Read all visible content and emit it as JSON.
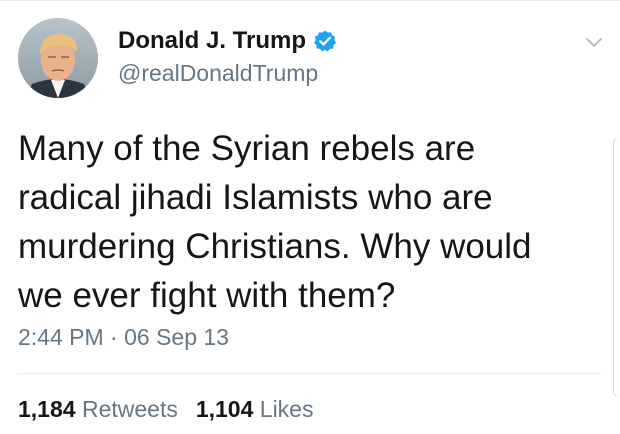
{
  "author": {
    "display_name": "Donald J. Trump",
    "handle": "@realDonaldTrump",
    "verified": true
  },
  "tweet": {
    "text_lines": [
      "Many of the Syrian rebels are",
      "radical jihadi Islamists who are",
      "murdering Christians. Why would",
      "we ever fight with them?"
    ],
    "timestamp": "2:44 PM · 06 Sep 13"
  },
  "stats": {
    "retweets_count": "1,184",
    "retweets_label": "Retweets",
    "likes_count": "1,104",
    "likes_label": "Likes"
  },
  "icons": {
    "verified": "verified-badge-icon",
    "menu": "chevron-down-icon"
  },
  "colors": {
    "text_primary": "#14171a",
    "text_secondary": "#657786",
    "verified_blue": "#1da1f2",
    "divider": "#e6ecf0"
  }
}
